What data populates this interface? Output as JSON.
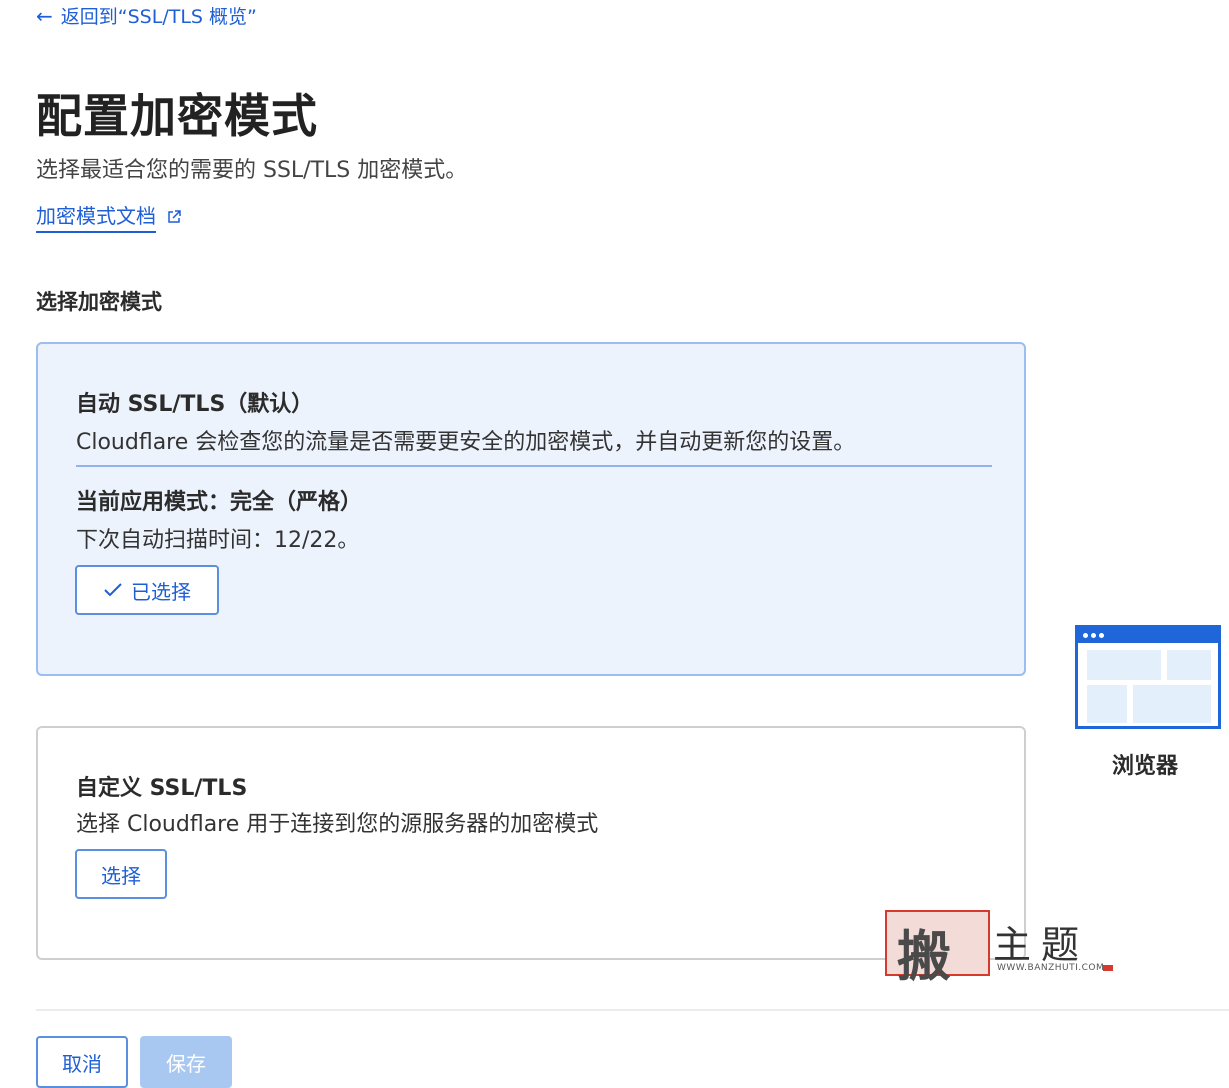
{
  "nav": {
    "back_label": "返回到“SSL/TLS 概览”"
  },
  "page": {
    "title": "配置加密模式",
    "subtitle": "选择最适合您的需要的 SSL/TLS 加密模式。",
    "doc_link": "加密模式文档"
  },
  "section": {
    "label": "选择加密模式"
  },
  "auto_card": {
    "title": "自动 SSL/TLS（默认）",
    "description": "Cloudflare 会检查您的流量是否需要更安全的加密模式，并自动更新您的设置。",
    "current_mode": "当前应用模式：完全（严格）",
    "next_scan": "下次自动扫描时间：12/22。",
    "selected_label": "已选择"
  },
  "custom_card": {
    "title": "自定义 SSL/TLS",
    "description": "选择 Cloudflare 用于连接到您的源服务器的加密模式",
    "select_label": "选择"
  },
  "illustration": {
    "label": "浏览器"
  },
  "watermark": {
    "big": "主题",
    "seal": "搬",
    "url": "WWW.BANZHUTI.COM"
  },
  "footer": {
    "cancel_label": "取消",
    "save_label": "保存"
  },
  "colors": {
    "accent": "#1f5fd6",
    "card_selected_bg": "#edf3fd",
    "disabled_button": "#a9c8f1"
  }
}
